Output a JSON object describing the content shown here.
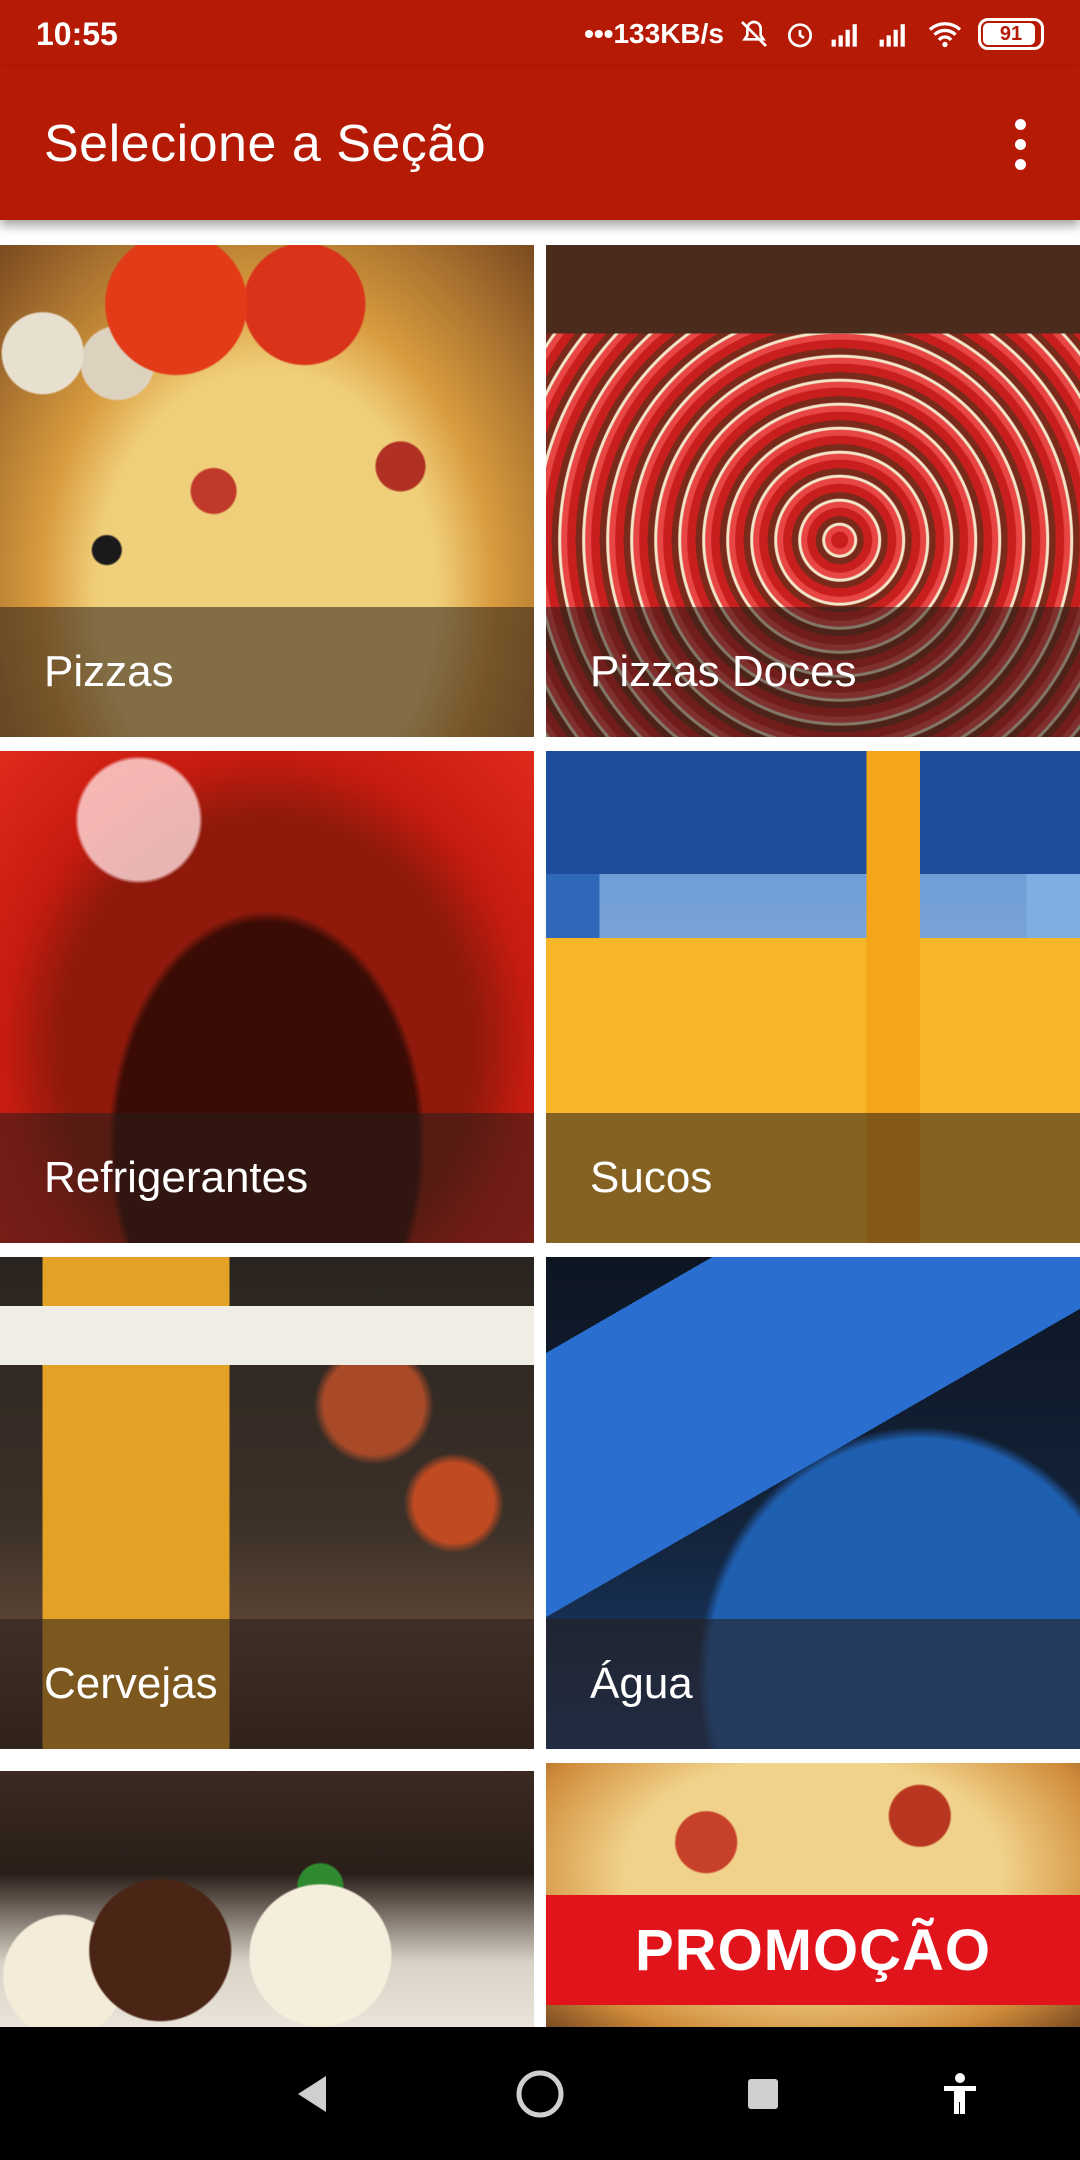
{
  "status_bar": {
    "time": "10:55",
    "network_speed": "•••133KB/s",
    "battery": "91",
    "icons": [
      "mute-icon",
      "alarm-icon",
      "signal-icon",
      "signal-icon",
      "wifi-icon",
      "battery-icon"
    ]
  },
  "app_bar": {
    "title": "Selecione a Seção",
    "menu_icon": "more-vert-icon"
  },
  "sections": [
    {
      "label": "Pizzas"
    },
    {
      "label": "Pizzas Doces"
    },
    {
      "label": "Refrigerantes"
    },
    {
      "label": "Sucos"
    },
    {
      "label": "Cervejas"
    },
    {
      "label": "Água"
    },
    {
      "label": ""
    },
    {
      "label": "",
      "banner": "PROMOÇÃO"
    }
  ],
  "nav_bar": {
    "icons": [
      "back-icon",
      "home-icon",
      "recents-icon",
      "accessibility-icon"
    ]
  },
  "colors": {
    "primary": "#b51a05",
    "promo_banner": "#e2141b",
    "nav_background": "#000000"
  }
}
